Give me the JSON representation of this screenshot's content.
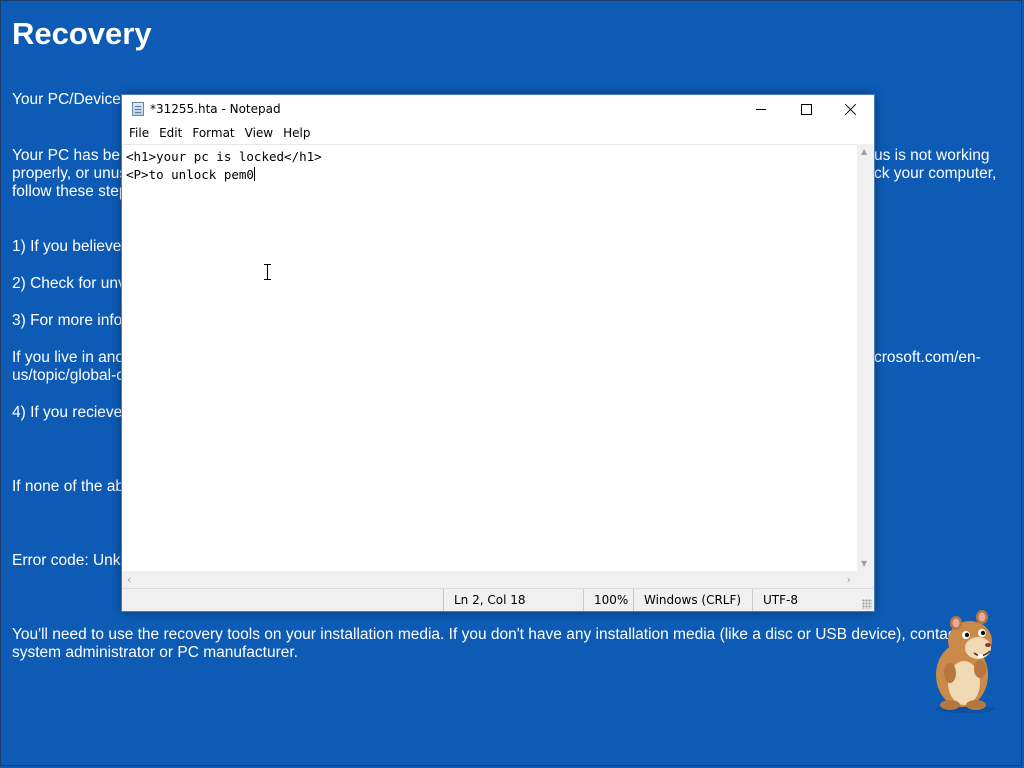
{
  "background": {
    "title": "Recovery",
    "lines": [
      "Your PC/Device",
      "Your PC has be",
      "properly, or unus",
      "follow these step",
      "1) If you believe",
      "2) Check for unv",
      "3) For more info",
      "If you live in anot",
      "us/topic/global-c",
      "4) If you recieve",
      "If none of the ab",
      "Error code: Unk"
    ],
    "right_fragments": {
      "line2": "us is not working",
      "line3": "ck your computer,",
      "line7": "crosoft.com/en-"
    },
    "bottom_text_1": "You'll need to use the recovery tools on your installation media. If you don't have any installation media (like a disc or USB device), contac",
    "bottom_text_2": "system administrator or PC manufacturer."
  },
  "notepad": {
    "title": "*31255.hta - Notepad",
    "menu": [
      "File",
      "Edit",
      "Format",
      "View",
      "Help"
    ],
    "content_lines": [
      "<h1>your pc is locked</h1>",
      "<P>to unlock pem0"
    ],
    "status": {
      "position": "Ln 2, Col 18",
      "zoom": "100%",
      "line_ending": "Windows (CRLF)",
      "encoding": "UTF-8"
    }
  },
  "colors": {
    "desktop_background": "#0d5bb5",
    "text": "#ffffff"
  },
  "icons": [
    "notepad-app-icon",
    "minimize-icon",
    "maximize-icon",
    "close-icon",
    "text-cursor-ibeam-icon",
    "hamster-mascot"
  ]
}
